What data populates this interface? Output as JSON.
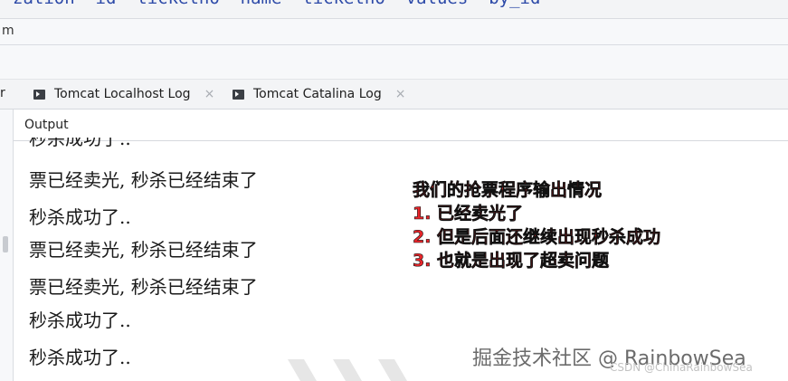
{
  "top_code_fragment": "zation  id  ticketno  name  ticketno  values  by_id",
  "path_fragment": "m",
  "tabs": {
    "stub_label": "r",
    "items": [
      {
        "label": "Tomcat Localhost Log",
        "close": "×"
      },
      {
        "label": "Tomcat Catalina Log",
        "close": "×"
      }
    ]
  },
  "output": {
    "label": "Output",
    "lines": [
      "秒杀成功了..",
      "票已经卖光, 秒杀已经结束了",
      "秒杀成功了..",
      "票已经卖光, 秒杀已经结束了",
      "票已经卖光, 秒杀已经结束了",
      "秒杀成功了..",
      "秒杀成功了.."
    ]
  },
  "annotation": {
    "title": "我们的抢票程序输出情况",
    "points": [
      "1. 已经卖光了",
      "2. 但是后面还继续出现秒杀成功",
      "3. 也就是出现了超卖问题"
    ]
  },
  "watermark": {
    "primary": "掘金技术社区 @ RainbowSea",
    "secondary": "CSDN @ChinaRainbowSea"
  },
  "colors": {
    "annotation_text": "#e8262b",
    "annotation_outline": "#111111",
    "code_keyword": "#2d4aa8"
  }
}
